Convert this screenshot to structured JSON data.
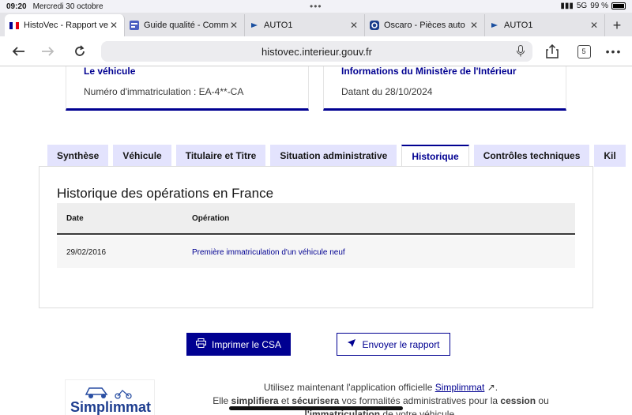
{
  "status": {
    "time": "09:20",
    "date": "Mercredi 30 octobre",
    "network": "5G",
    "battery": "99 %"
  },
  "browser_tabs": [
    {
      "title": "HistoVec - Rapport ve",
      "favicon": "flag-fr-icon",
      "active": true
    },
    {
      "title": "Guide qualité - Comm",
      "favicon": "guide-icon",
      "active": false
    },
    {
      "title": "AUTO1",
      "favicon": "auto1-icon",
      "active": false
    },
    {
      "title": "Oscaro - Pièces auto",
      "favicon": "oscaro-icon",
      "active": false
    },
    {
      "title": "AUTO1",
      "favicon": "auto1-icon",
      "active": false
    }
  ],
  "toolbar": {
    "url": "histovec.interieur.gouv.fr",
    "tab_count": "5"
  },
  "cards": {
    "vehicle": {
      "title": "Le véhicule",
      "value": "Numéro d'immatriculation : EA-4**-CA"
    },
    "ministry": {
      "title": "Informations du Ministère de l'Intérieur",
      "value": "Datant du 28/10/2024"
    }
  },
  "page_tabs": [
    "Synthèse",
    "Véhicule",
    "Titulaire et Titre",
    "Situation administrative",
    "Historique",
    "Contrôles techniques",
    "Kil"
  ],
  "history": {
    "heading": "Historique des opérations en France",
    "columns": {
      "date": "Date",
      "operation": "Opération"
    },
    "rows": [
      {
        "date": "29/02/2016",
        "operation": "Première immatriculation d'un véhicule neuf"
      }
    ]
  },
  "actions": {
    "print": "Imprimer le CSA",
    "send": "Envoyer le rapport"
  },
  "promo": {
    "logo_text": "Simplimmat",
    "line1_pre": "Utilisez maintenant l'application officielle ",
    "link": "Simplimmat",
    "line1_post": ".",
    "line2_pre": "Elle ",
    "bold1": "simplifiera",
    "line2_mid": " et ",
    "bold2": "sécurisera",
    "line2_post": " vos formalités administratives pour la ",
    "bold3": "cession",
    "line2_end": " ou",
    "line3_bold": "l'immatriculation",
    "line3_post": " de votre véhicule."
  },
  "colors": {
    "accent": "#000091",
    "tab_bg": "#e3e3fd"
  }
}
